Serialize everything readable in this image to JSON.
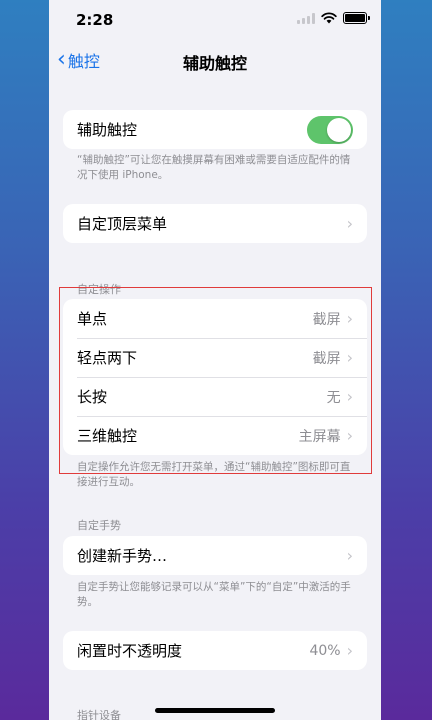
{
  "status_bar": {
    "time": "2:28"
  },
  "nav": {
    "back_label": "触控",
    "title": "辅助触控"
  },
  "assistive_touch": {
    "label": "辅助触控",
    "toggle_on": true,
    "toggle_color": "#5ec46b",
    "footer": "“辅助触控”可让您在触摸屏幕有困难或需要自适应配件的情况下使用 iPhone。"
  },
  "top_menu": {
    "label": "自定顶层菜单"
  },
  "custom_actions": {
    "header": "自定操作",
    "items": [
      {
        "label": "单点",
        "value": "截屏"
      },
      {
        "label": "轻点两下",
        "value": "截屏"
      },
      {
        "label": "长按",
        "value": "无"
      },
      {
        "label": "三维触控",
        "value": "主屏幕"
      }
    ],
    "footer": "自定操作允许您无需打开菜单，通过“辅助触控”图标即可直接进行互动。"
  },
  "custom_gestures": {
    "header": "自定手势",
    "create_label": "创建新手势…",
    "footer": "自定手势让您能够记录可以从“菜单”下的“自定”中激活的手势。"
  },
  "idle_opacity": {
    "label": "闲置时不透明度",
    "value": "40%"
  },
  "pointer_devices": {
    "header": "指针设备"
  },
  "colors": {
    "accent": "#1a73e8",
    "highlight": "#e03b3b"
  }
}
